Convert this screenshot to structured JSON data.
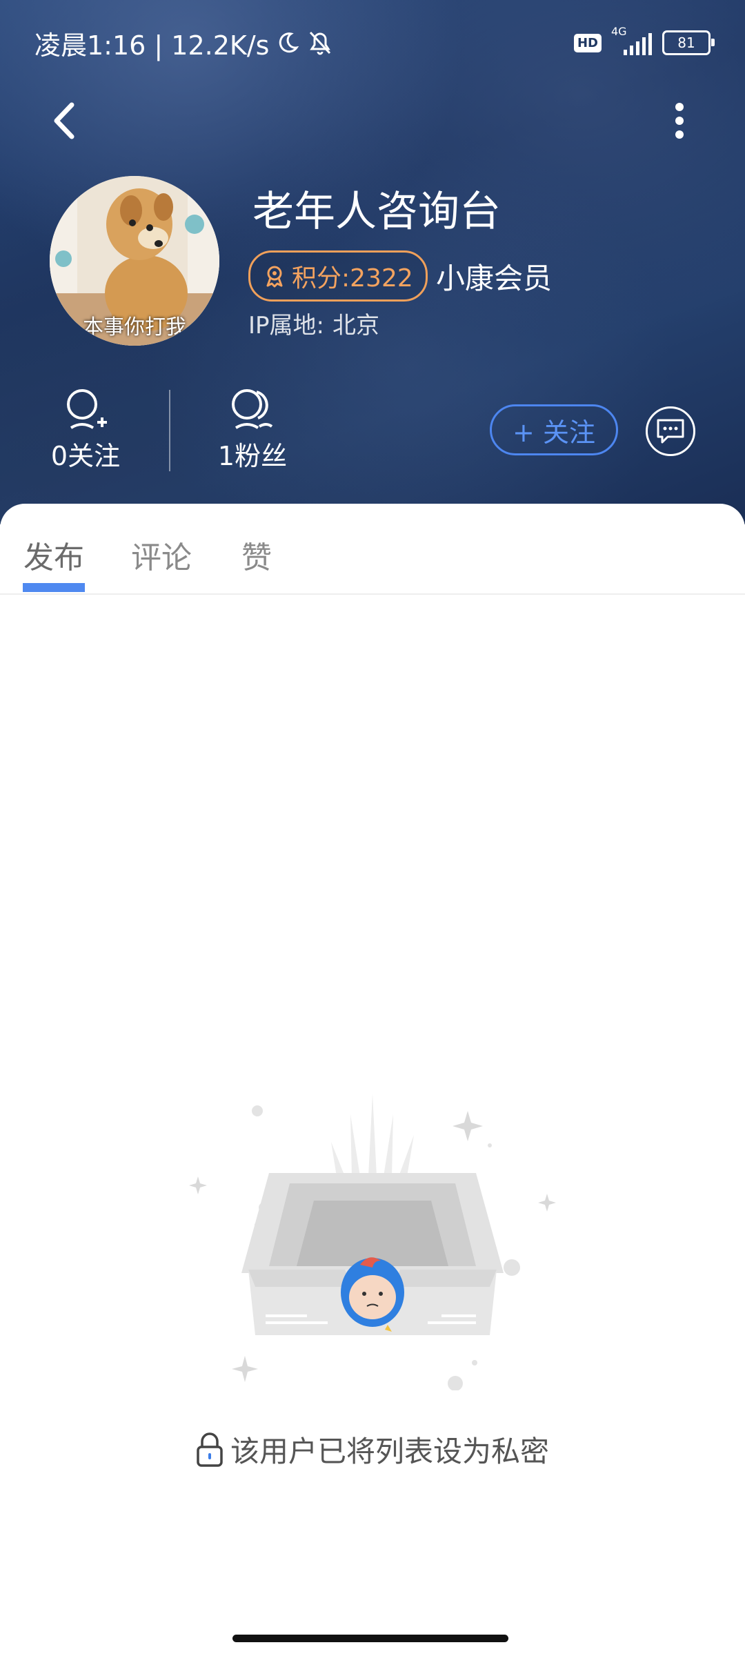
{
  "status_bar": {
    "time_speed": "凌晨1:16 | 12.2K/s",
    "hd": "HD",
    "network": "4G",
    "battery": "81"
  },
  "header": {
    "back_icon": "chevron-left-icon",
    "more_icon": "more-vertical-icon"
  },
  "profile": {
    "username": "老年人咨询台",
    "points": "积分:2322",
    "member": "小康会员",
    "ip_label": "IP属地:",
    "ip_value": "北京",
    "avatar_caption": "本事你打我"
  },
  "stats": {
    "following": "0关注",
    "followers": "1粉丝"
  },
  "actions": {
    "follow_label": "+ 关注"
  },
  "tabs": [
    "发布",
    "评论",
    "赞"
  ],
  "empty_state": {
    "message": "该用户已将列表设为私密"
  },
  "colors": {
    "accent": "#4f89f0",
    "points": "#f4a35f",
    "header_bg": "#1d3561"
  }
}
